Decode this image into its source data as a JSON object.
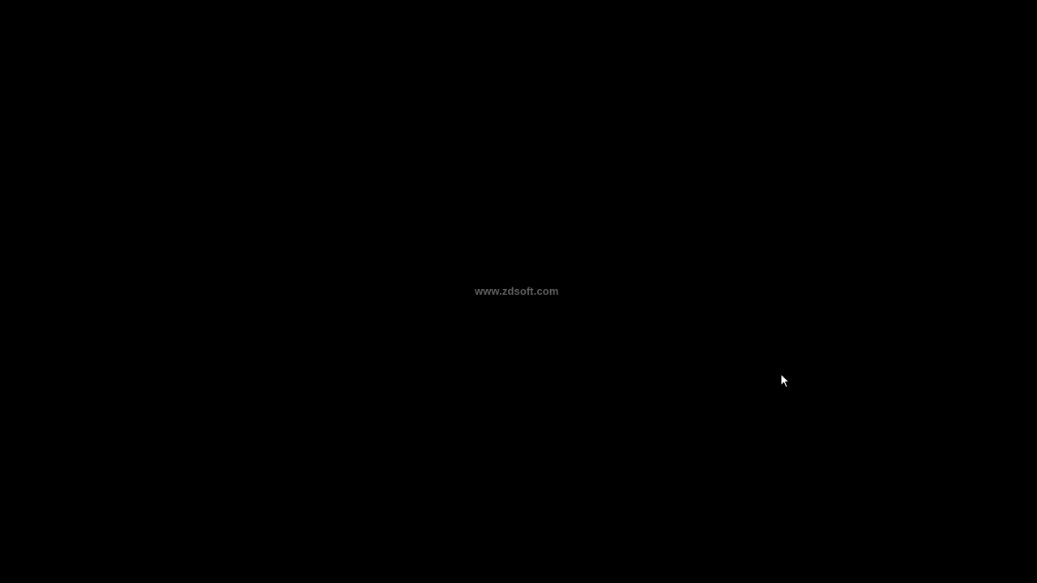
{
  "screen": {
    "background_color": "#000000",
    "watermark_text": "www.zdsoft.com",
    "watermark_color": "#5f5f5f",
    "cursor_icon": "arrow-cursor-icon"
  }
}
